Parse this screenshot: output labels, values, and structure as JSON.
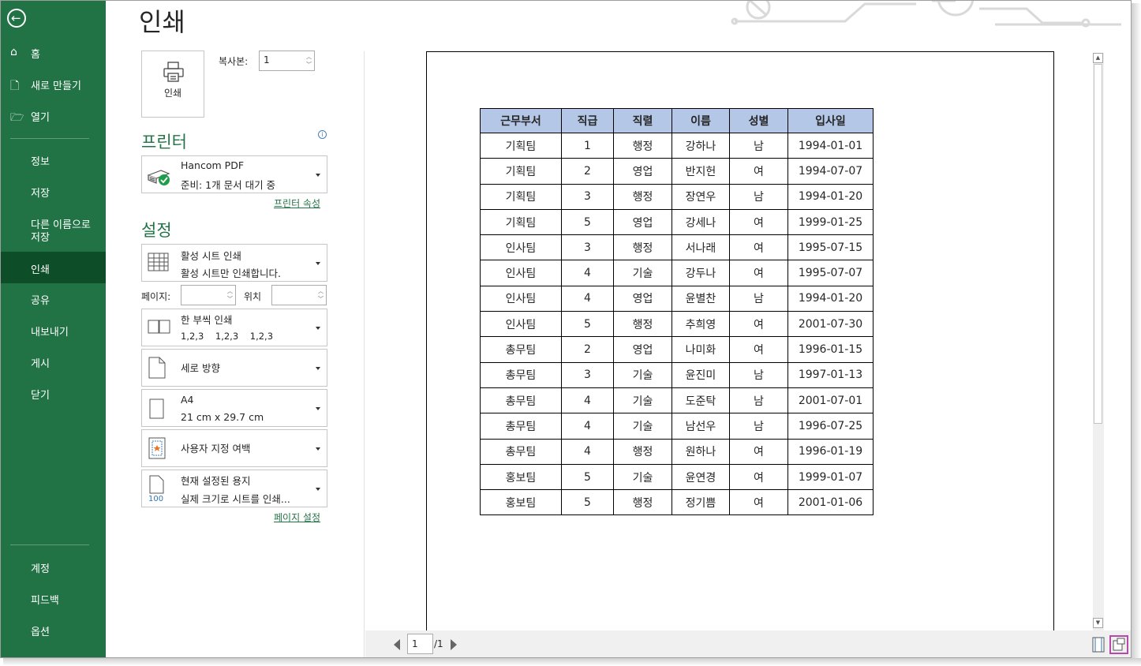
{
  "backstage": {
    "nav": {
      "home": "홈",
      "new": "새로 만들기",
      "open": "열기",
      "info": "정보",
      "save": "저장",
      "save_as_line1": "다른 이름으로",
      "save_as_line2": "저장",
      "print": "인쇄",
      "share": "공유",
      "export": "내보내기",
      "publish": "게시",
      "close": "닫기",
      "account": "계정",
      "feedback": "피드백",
      "options": "옵션"
    },
    "selected": "인쇄"
  },
  "print_panel": {
    "title": "인쇄",
    "print_button_label": "인쇄",
    "copies_label": "복사본:",
    "copies_value": "1",
    "printer_section": "프린터",
    "printer": {
      "name": "Hancom PDF",
      "status": "준비: 1개 문서 대기 중"
    },
    "printer_properties_link": "프린터 속성",
    "settings_section": "설정",
    "what_to_print": {
      "title": "활성 시트 인쇄",
      "sub": "활성 시트만 인쇄합니다."
    },
    "pages_label": "페이지:",
    "pages_from": "",
    "pages_to_label": "위치",
    "pages_to": "",
    "collate": {
      "title": "한 부씩 인쇄",
      "sub": "1,2,3    1,2,3    1,2,3"
    },
    "orientation": {
      "title": "세로 방향"
    },
    "paper": {
      "title": "A4",
      "sub": "21 cm x 29.7 cm"
    },
    "margins": {
      "title": "사용자 지정 여백"
    },
    "scaling": {
      "title": "현재 설정된 용지",
      "sub": "실제 크기로 시트를 인쇄..."
    },
    "page_setup_link": "페이지 설정"
  },
  "preview": {
    "headers": [
      "근무부서",
      "직급",
      "직렬",
      "이름",
      "성별",
      "입사일"
    ],
    "rows": [
      [
        "기획팀",
        "1",
        "행정",
        "강하나",
        "남",
        "1994-01-01"
      ],
      [
        "기획팀",
        "2",
        "영업",
        "반지헌",
        "여",
        "1994-07-07"
      ],
      [
        "기획팀",
        "3",
        "행정",
        "장연우",
        "남",
        "1994-01-20"
      ],
      [
        "기획팀",
        "5",
        "영업",
        "강세나",
        "여",
        "1999-01-25"
      ],
      [
        "인사팀",
        "3",
        "행정",
        "서나래",
        "여",
        "1995-07-15"
      ],
      [
        "인사팀",
        "4",
        "기술",
        "강두나",
        "여",
        "1995-07-07"
      ],
      [
        "인사팀",
        "4",
        "영업",
        "윤별찬",
        "남",
        "1994-01-20"
      ],
      [
        "인사팀",
        "5",
        "행정",
        "추희영",
        "여",
        "2001-07-30"
      ],
      [
        "총무팀",
        "2",
        "영업",
        "나미화",
        "여",
        "1996-01-15"
      ],
      [
        "총무팀",
        "3",
        "기술",
        "윤진미",
        "남",
        "1997-01-13"
      ],
      [
        "총무팀",
        "4",
        "기술",
        "도준탁",
        "남",
        "2001-07-01"
      ],
      [
        "총무팀",
        "4",
        "기술",
        "남선우",
        "남",
        "1996-07-25"
      ],
      [
        "총무팀",
        "4",
        "행정",
        "원하나",
        "여",
        "1996-01-19"
      ],
      [
        "홍보팀",
        "5",
        "기술",
        "윤연경",
        "여",
        "1999-01-07"
      ],
      [
        "홍보팀",
        "5",
        "행정",
        "정기쁨",
        "여",
        "2001-01-06"
      ]
    ],
    "current_page": "1",
    "total_pages": "/1"
  },
  "colors": {
    "sidebar": "#217346",
    "sidebar_selected": "#0d4d27",
    "header_fill": "#b4c7e7",
    "accent": "#217346"
  }
}
